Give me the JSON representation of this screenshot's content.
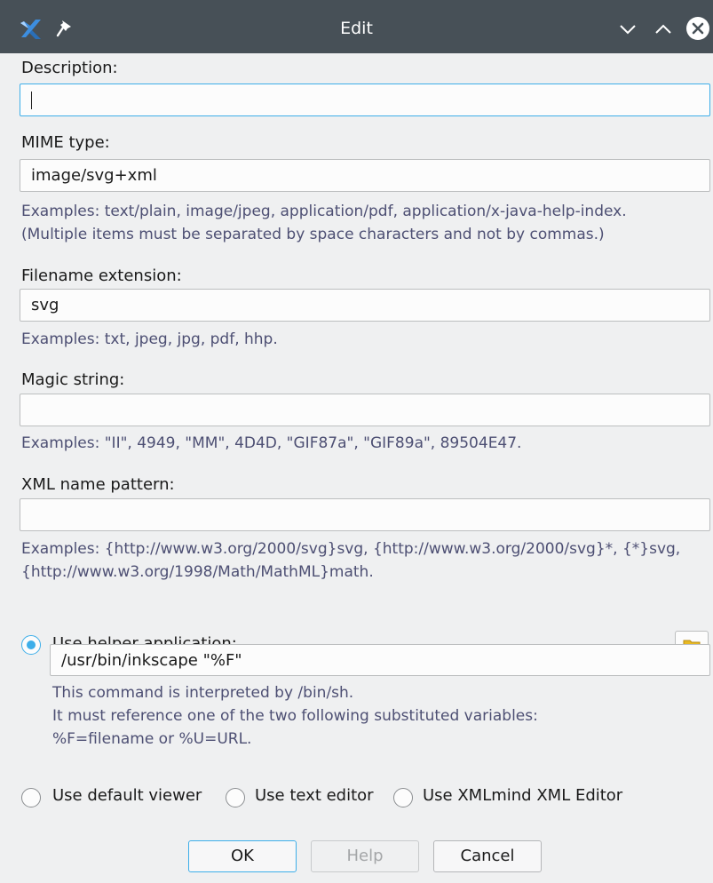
{
  "window": {
    "title": "Edit",
    "icons": [
      "app-icon",
      "pin-icon",
      "minimize-icon",
      "maximize-icon",
      "close-icon"
    ]
  },
  "description": {
    "label": "Description:",
    "value": ""
  },
  "mime_type": {
    "label": "MIME type:",
    "value": "image/svg+xml",
    "hint_line1": "Examples: text/plain, image/jpeg, application/pdf, application/x-java-help-index.",
    "hint_line2": "(Multiple items must be separated by space characters and not by commas.)"
  },
  "filename_extension": {
    "label": "Filename extension:",
    "value": "svg",
    "hint": "Examples: txt, jpeg, jpg, pdf, hhp."
  },
  "magic_string": {
    "label": "Magic string:",
    "value": "",
    "hint": "Examples: \"II\", 4949, \"MM\", 4D4D, \"GIF87a\", \"GIF89a\", 89504E47."
  },
  "xml_name_pattern": {
    "label": "XML name pattern:",
    "value": "",
    "hint_line1": "Examples: {http://www.w3.org/2000/svg}svg, {http://www.w3.org/2000/svg}*, {*}svg,",
    "hint_line2": "{http://www.w3.org/1998/Math/MathML}math."
  },
  "helper": {
    "label": "Use helper application:",
    "selected": true,
    "command": "/usr/bin/inkscape \"%F\"",
    "note_line1": "This command is interpreted by /bin/sh.",
    "note_line2": "It must reference one of the two following substituted variables:",
    "note_line3": "%F=filename or %U=URL.",
    "browse_icon": "folder-icon"
  },
  "viewer_options": [
    {
      "label": "Use default viewer",
      "selected": false
    },
    {
      "label": "Use text editor",
      "selected": false
    },
    {
      "label": "Use XMLmind XML Editor",
      "selected": false
    }
  ],
  "buttons": {
    "ok": "OK",
    "help": "Help",
    "cancel": "Cancel"
  },
  "colors": {
    "titlebar": "#475057",
    "accent": "#3daee9",
    "hint_text": "#4d4f73",
    "background": "#eff0f1"
  }
}
